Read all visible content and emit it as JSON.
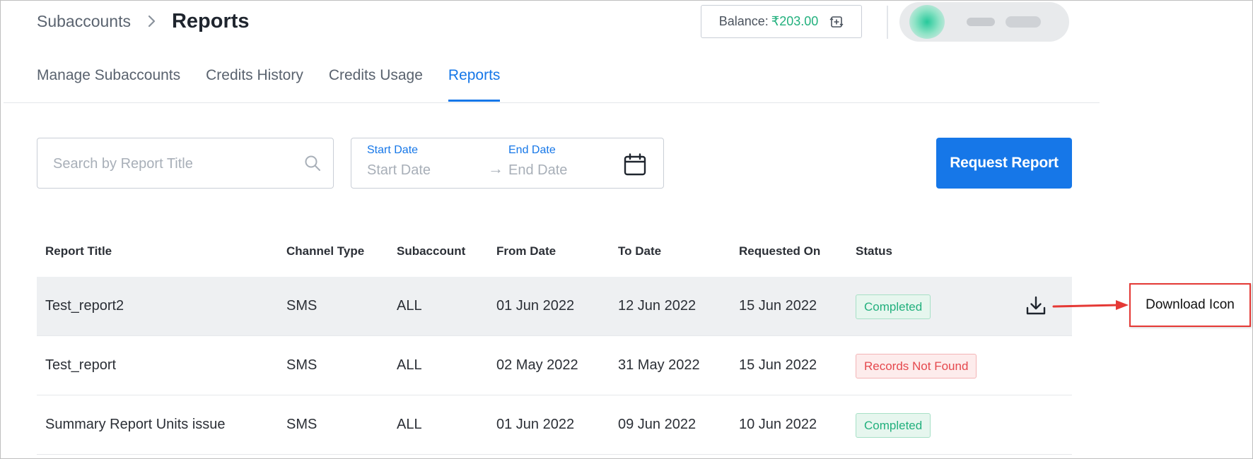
{
  "breadcrumb": {
    "parent": "Subaccounts",
    "current": "Reports"
  },
  "balance": {
    "label": "Balance:",
    "amount": "₹203.00"
  },
  "tabs": [
    {
      "label": "Manage Subaccounts",
      "active": false
    },
    {
      "label": "Credits History",
      "active": false
    },
    {
      "label": "Credits Usage",
      "active": false
    },
    {
      "label": "Reports",
      "active": true
    }
  ],
  "search": {
    "placeholder": "Search by Report Title"
  },
  "date_range": {
    "start_label": "Start Date",
    "start_placeholder": "Start Date",
    "end_label": "End Date",
    "end_placeholder": "End Date",
    "separator": "→"
  },
  "request_button": "Request Report",
  "table": {
    "headers": [
      "Report Title",
      "Channel Type",
      "Subaccount",
      "From Date",
      "To Date",
      "Requested On",
      "Status"
    ],
    "rows": [
      {
        "title": "Test_report2",
        "channel": "SMS",
        "subaccount": "ALL",
        "from": "01 Jun 2022",
        "to": "12 Jun 2022",
        "requested": "15 Jun 2022",
        "status": "Completed"
      },
      {
        "title": "Test_report",
        "channel": "SMS",
        "subaccount": "ALL",
        "from": "02 May 2022",
        "to": "31 May 2022",
        "requested": "15 Jun 2022",
        "status": "Records Not Found"
      },
      {
        "title": "Summary Report Units issue",
        "channel": "SMS",
        "subaccount": "ALL",
        "from": "01 Jun 2022",
        "to": "09 Jun 2022",
        "requested": "10 Jun 2022",
        "status": "Completed"
      }
    ]
  },
  "annotation": {
    "label": "Download Icon"
  },
  "colors": {
    "accent": "#1677e8",
    "success": "#22b07d",
    "error": "#e5484d",
    "annotation": "#e53935"
  },
  "icons": {
    "download": "download-icon",
    "search": "search-icon",
    "calendar": "calendar-icon",
    "refresh_balance": "recharge-icon",
    "breadcrumb_separator": "chevron-right-icon"
  }
}
